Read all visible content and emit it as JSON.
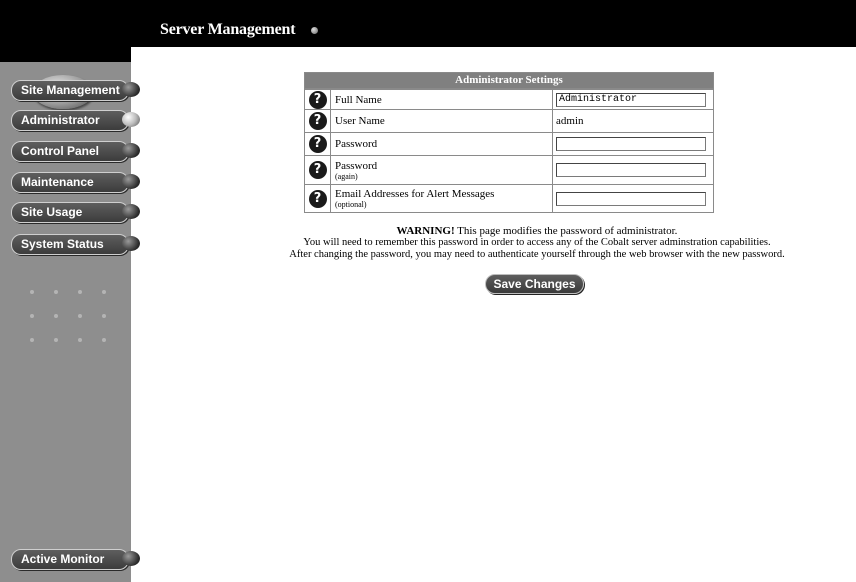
{
  "header": {
    "title": "Server Management"
  },
  "sidebar": {
    "logo_icon": "cobalt-logo-icon",
    "items": [
      {
        "label": "Site Management",
        "active": false
      },
      {
        "label": "Administrator",
        "active": true
      },
      {
        "label": "Control Panel",
        "active": false
      },
      {
        "label": "Maintenance",
        "active": false
      },
      {
        "label": "Site Usage",
        "active": false
      },
      {
        "label": "System Status",
        "active": false
      }
    ],
    "active_monitor": "Active Monitor"
  },
  "settings": {
    "title": "Administrator Settings",
    "rows": [
      {
        "label": "Full Name",
        "sub": "",
        "value": "Administrator",
        "type": "input"
      },
      {
        "label": "User Name",
        "sub": "",
        "value": "admin",
        "type": "text"
      },
      {
        "label": "Password",
        "sub": "",
        "value": "",
        "type": "password"
      },
      {
        "label": "Password",
        "sub": "(again)",
        "value": "",
        "type": "password"
      },
      {
        "label": "Email Addresses for Alert Messages",
        "sub": "(optional)",
        "value": "",
        "type": "input"
      }
    ]
  },
  "warning": {
    "strong": "WARNING!",
    "line1_rest": " This page modifies the password of administrator.",
    "line2": "You will need to remember this password in order to access any of the Cobalt server adminstration capabilities.",
    "line3": "After changing the password, you may need to authenticate yourself through the web browser with the new password."
  },
  "save_button": "Save Changes",
  "colors": {
    "sidebar": "#8e8e8e",
    "header": "#000000",
    "table_header": "#808080"
  }
}
